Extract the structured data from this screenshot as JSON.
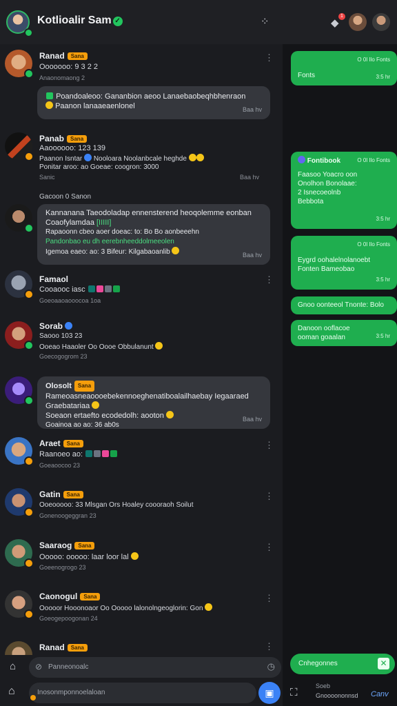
{
  "header": {
    "title": "Kotlioalir Sam",
    "icons": [
      "profile-avatar",
      "verified-icon",
      "filter-icon",
      "notification-icon",
      "contact-avatar"
    ],
    "notif_count": "1"
  },
  "chats": [
    {
      "name": "Ranad",
      "tag": "Sana",
      "line1": "Ooooooo: 9 3 2 2",
      "line2": "Anaonomaong 2",
      "kind": "row"
    },
    {
      "kind": "bubble",
      "l1": "Poandoaleoo: Gananbion aeoo Lanaebaobeqhbhenraon",
      "l2": "Paanon lanaaeaenlonel",
      "time": "Baa hv"
    },
    {
      "name": "Panab",
      "tag": "Sana",
      "line1": "Aaoooooo: 123 139",
      "l_a": "Paanon Isntar",
      "l_b": "Nooloara Noolanbcale heghde",
      "l_c": "Ponitar aroo: ao Goeae: coogron: 3000",
      "l_d": "Sanic",
      "time": "Baa hv",
      "kind": "row-multi"
    },
    {
      "kind": "label",
      "text": "Gacoon 0 Sanon"
    },
    {
      "kind": "bubble",
      "l1": "Kannanana Taeodoladap ennensterend heoqolemme eonban",
      "l2": "Coaofylamdaa",
      "l3": "Rapaoonn cbeo aoer doeac: to: Bo Bo aonbeeehn",
      "l4": "Pandonbao eu dh eerebnheeddolmeeolen",
      "l5": "Igemoa eaeo: ao: 3 Bifeur: Kilgabaoanlib",
      "time": "Baa hv"
    },
    {
      "name": "Famaol",
      "line1": "Cooaooc iasc",
      "line2": "Goeoaaoaooocoa 1oa",
      "kind": "row"
    },
    {
      "name": "Sorab",
      "line1": "Saooo 103 23",
      "line1b": "Ooeao Haaoler Oo Oooe Obbulanunt",
      "line2": "Goecogogrom 23",
      "kind": "row"
    },
    {
      "kind": "bubble",
      "name": "Olosolt",
      "tag": "Sana",
      "l1": "Rameoasneaoooebekennoeghenatiboalailhaebay Iegaaraed",
      "l2": "Graebatariaa",
      "l3": "Soeaon ertaefto ecodedolh: aooton",
      "l4": "Goainoa ao ao: 36 ab0s",
      "time": "Baa hv"
    },
    {
      "name": "Araet",
      "tag": "Sana",
      "line1": "Raanoeo ao:",
      "line2": "Goeaoocoo 23",
      "kind": "row"
    },
    {
      "name": "Gatin",
      "tag": "Sana",
      "line1": "Ooeooooo: 33 Mlsgan Ors Hoaley coooraoh Soilut",
      "line2": "Gonenoogeggran 23",
      "kind": "row"
    },
    {
      "name": "Saaraog",
      "tag": "Sana",
      "line1": "Ooooo: ooooo: laar loor lal",
      "line2": "Goeenogrogo 23",
      "kind": "row"
    },
    {
      "name": "Caonogul",
      "tag": "Sana",
      "line1": "Ooooor Hooonoaor Oo Ooooo lalonolngeoglorin: Gon",
      "line2": "Goeogepoogonan 24",
      "kind": "row"
    },
    {
      "name": "Ranad",
      "tag": "Sana",
      "kind": "row"
    }
  ],
  "right_panel": {
    "bubbles": [
      {
        "head": "O 0l Ilo Fonts",
        "text": "Fonts",
        "time": "3:5 hr"
      },
      {
        "head": "O 0l Ilo Fonts",
        "title": "Fontibook",
        "text": "Faasoo Yoacro oon Onolhon Bonolaae: 2 Isnecoeolnb Bebbota",
        "time": "3:5 hr"
      },
      {
        "head": "O 0l Ilo Fonts",
        "text": "Eygrd oohalelnolanoebt Fonten Bameobao",
        "time": "3:5 hr"
      },
      {
        "text": "Gnoo oonteeol Tnonte: Bolo",
        "time": ""
      },
      {
        "text": "Danoon ooflacoe ooman goaalan",
        "time": "3:5 hr"
      }
    ],
    "footer_pill": "Cnhegonnes",
    "footer_label": "Soeb",
    "footer_sub": "Gnoooononnsd",
    "footer_link": "Canv"
  },
  "composer": {
    "search_placeholder": "Panneonoalc",
    "message_placeholder": "Inosonmponnoelaloan"
  },
  "colors": {
    "accent_green": "#1fae4f",
    "tag_orange": "#f59e0b",
    "send_blue": "#3b82f6",
    "bg": "#1b1c20"
  }
}
